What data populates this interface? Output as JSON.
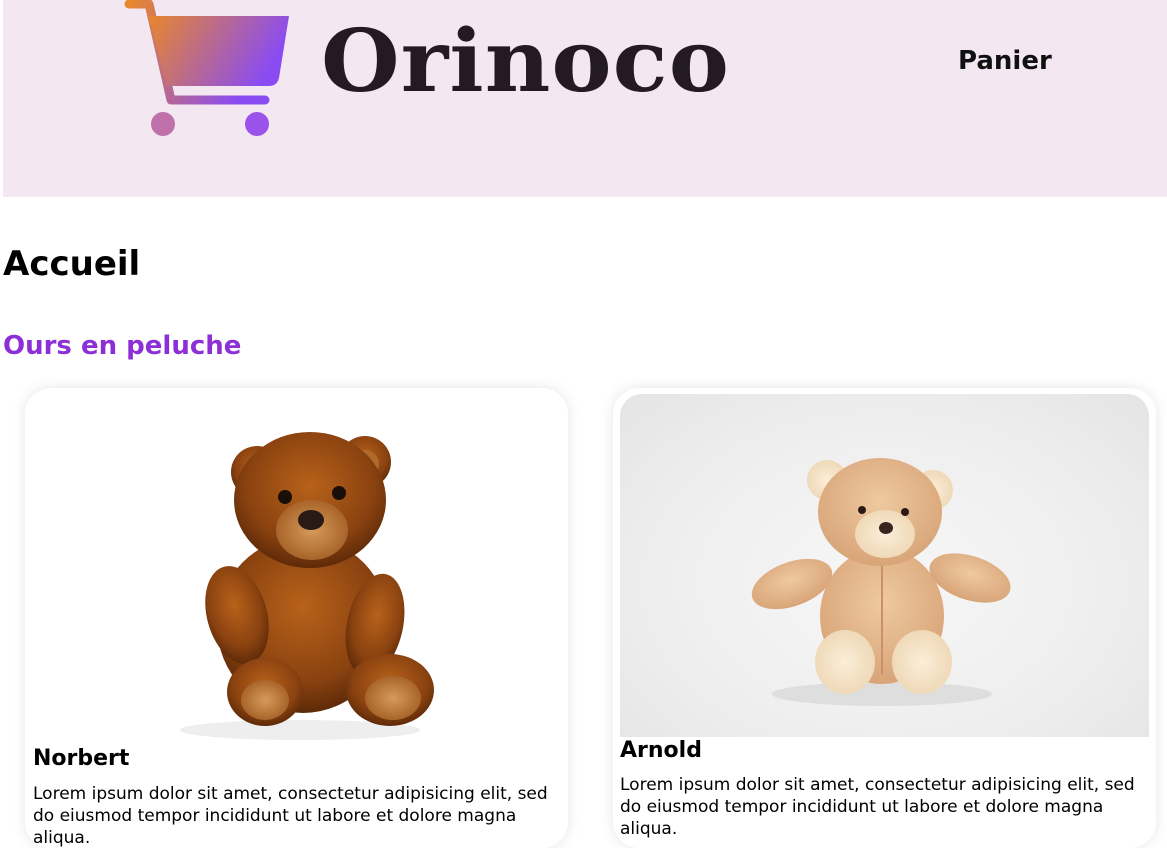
{
  "header": {
    "logo_text": "Orinoco",
    "nav_cart_label": "Panier"
  },
  "main": {
    "page_title": "Accueil",
    "section_title": "Ours en peluche",
    "products": [
      {
        "name": "Norbert",
        "description": "Lorem ipsum dolor sit amet, consectetur adipisicing elit, sed do eiusmod tempor incididunt ut labore et dolore magna aliqua.",
        "image": "brown-teddy-bear"
      },
      {
        "name": "Arnold",
        "description": "Lorem ipsum dolor sit amet, consectetur adipisicing elit, sed do eiusmod tempor incididunt ut labore et dolore magna aliqua.",
        "image": "beige-teddy-bear"
      }
    ]
  },
  "colors": {
    "header_background": "#f3e8f1",
    "section_title": "#8c2fd6",
    "logo_text": "#241a24",
    "cart_gradient_start": "#e8872c",
    "cart_gradient_end": "#8a4cf2"
  },
  "icons": {
    "logo": "shopping-cart-icon"
  }
}
